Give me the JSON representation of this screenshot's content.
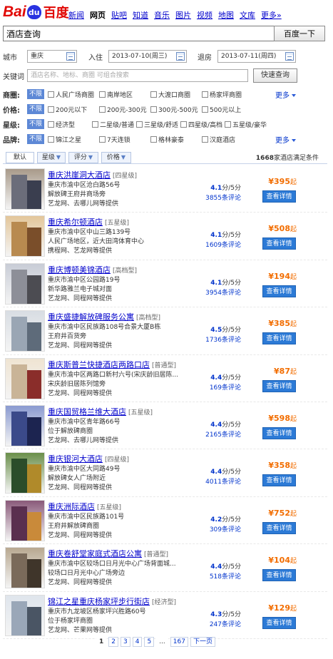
{
  "brand": {
    "logo_left": "Bai",
    "logo_paw": "du",
    "logo_right": "百度"
  },
  "nav": [
    "新闻",
    "网页",
    "贴吧",
    "知道",
    "音乐",
    "图片",
    "视频",
    "地图",
    "文库",
    "更多»"
  ],
  "search": {
    "value": "酒店查询",
    "button": "百度一下"
  },
  "filters": {
    "city_label": "城市",
    "city_value": "重庆",
    "checkin_label": "入住",
    "checkin_value": "2013-07-10(周三)",
    "checkout_label": "退房",
    "checkout_value": "2013-07-11(周四)",
    "keyword_label": "关键词",
    "keyword_placeholder": "酒店名称、地标、商圈 可组合搜索",
    "query_button": "快速查询",
    "unlimited": "不限",
    "more": "更多",
    "rows": [
      {
        "label": "商圈:",
        "options": [
          "人民广场商圈",
          "南岸地区",
          "大渡口商圈",
          "杨家坪商圈"
        ],
        "more": true
      },
      {
        "label": "价格:",
        "options": [
          "200元以下",
          "200元-300元",
          "300元-500元",
          "500元以上"
        ],
        "more": false
      },
      {
        "label": "星级:",
        "options": [
          "经济型",
          "二星级/普通",
          "三星级/舒适",
          "四星级/高档",
          "五星级/豪华"
        ],
        "more": false
      },
      {
        "label": "品牌:",
        "options": [
          "锦江之星",
          "7天连锁",
          "格林豪泰",
          "汉庭酒店"
        ],
        "more": true
      }
    ]
  },
  "sort": {
    "default": "默认",
    "star": "星级",
    "score": "评分",
    "price": "价格",
    "count_prefix": "1668",
    "count_suffix": "家酒店满足条件"
  },
  "hotels": [
    {
      "name": "重庆洪崖洞大酒店",
      "star": "[四星级]",
      "line1": "重庆市渝中区沧白路56号",
      "line2": "解放碑王府井商场旁",
      "line3": "艺龙网、去哪儿网等提供",
      "score": "4.1",
      "score_suffix": "分/5分",
      "reviews": "3855条评论",
      "price": "¥395",
      "price_suffix": "起",
      "detail": "查看详情",
      "palette": [
        "#6b6d7a",
        "#3a3e4f",
        "#a89a8a"
      ]
    },
    {
      "name": "重庆希尔顿酒店",
      "star": "[五星级]",
      "line1": "重庆市渝中区中山三路139号",
      "line2": "人民广场地区，近大田湾体育中心",
      "line3": "携程网、艺龙网等提供",
      "score": "4.1",
      "score_suffix": "分/5分",
      "reviews": "1609条评论",
      "price": "¥508",
      "price_suffix": "起",
      "detail": "查看详情",
      "palette": [
        "#b88a50",
        "#7a4e2a",
        "#e3c69a"
      ]
    },
    {
      "name": "重庆博顿美锦酒店",
      "star": "[高档型]",
      "line1": "重庆市渝中区公园路19号",
      "line2": "新华路雅兰电子城对面",
      "line3": "艺龙网、同程网等提供",
      "score": "4.1",
      "score_suffix": "分/5分",
      "reviews": "3954条评论",
      "price": "¥194",
      "price_suffix": "起",
      "detail": "查看详情",
      "palette": [
        "#8d8f98",
        "#4c4c52",
        "#c8ccd6"
      ]
    },
    {
      "name": "重庆盛捷解放碑服务公寓",
      "star": "[高档型]",
      "line1": "重庆市渝中区民族路108号合景大厦B栋",
      "line2": "王府井百货旁",
      "line3": "艺龙网、同程网等提供",
      "score": "4.5",
      "score_suffix": "分/5分",
      "reviews": "1736条评论",
      "price": "¥385",
      "price_suffix": "起",
      "detail": "查看详情",
      "palette": [
        "#9aa6b4",
        "#5e6b7a",
        "#d8dde3"
      ]
    },
    {
      "name": "重庆斯普兰快捷酒店两路口店",
      "star": "[普通型]",
      "line1": "重庆市渝中区两路口新村六号(宋庆龄旧居陈...",
      "line2": "宋庆龄旧居陈列馆旁",
      "line3": "艺龙网、同程网等提供",
      "score": "4.4",
      "score_suffix": "分/5分",
      "reviews": "169条评论",
      "price": "¥87",
      "price_suffix": "起",
      "detail": "查看详情",
      "palette": [
        "#c9b497",
        "#8a2d2a",
        "#efe4d2"
      ]
    },
    {
      "name": "重庆国贸格兰维大酒店",
      "star": "[五星级]",
      "line1": "重庆市渝中区青年路66号",
      "line2": "位于解放碑商圈",
      "line3": "艺龙网、去哪儿网等提供",
      "score": "4.4",
      "score_suffix": "分/5分",
      "reviews": "2165条评论",
      "price": "¥598",
      "price_suffix": "起",
      "detail": "查看详情",
      "palette": [
        "#3b4a8a",
        "#1c2450",
        "#8a9ad0"
      ]
    },
    {
      "name": "重庆银河大酒店",
      "star": "[四星级]",
      "line1": "重庆市渝中区大同路49号",
      "line2": "解放碑女人广场附近",
      "line3": "艺龙网、同程网等提供",
      "score": "4.4",
      "score_suffix": "分/5分",
      "reviews": "4011条评论",
      "price": "¥358",
      "price_suffix": "起",
      "detail": "查看详情",
      "palette": [
        "#2b4d2a",
        "#b08a2a",
        "#6a8f4a"
      ]
    },
    {
      "name": "重庆洲际酒店",
      "star": "[五星级]",
      "line1": "重庆市渝中区民族路101号",
      "line2": "王府井解放碑商圈",
      "line3": "艺龙网、同程网等提供",
      "score": "4.2",
      "score_suffix": "分/5分",
      "reviews": "309条评论",
      "price": "¥752",
      "price_suffix": "起",
      "detail": "查看详情",
      "palette": [
        "#5a2f4f",
        "#c98a3a",
        "#8a5a7a"
      ]
    },
    {
      "name": "重庆卷舒堂家庭式酒店公寓",
      "star": "[普通型]",
      "line1": "重庆市渝中区较场口日月光中心广场背面城...",
      "line2": "较场口日月光中心广场旁边",
      "line3": "艺龙网、同程网等提供",
      "score": "4.4",
      "score_suffix": "分/5分",
      "reviews": "518条评论",
      "price": "¥104",
      "price_suffix": "起",
      "detail": "查看详情",
      "palette": [
        "#7a6a5a",
        "#3f352a",
        "#b8a890"
      ]
    },
    {
      "name": "锦江之星重庆杨家坪步行街店",
      "star": "[经济型]",
      "line1": "重庆市九龙坡区杨家坪兴胜路60号",
      "line2": "位于杨家坪商圈",
      "line3": "艺龙网、芒果网等提供",
      "score": "4.3",
      "score_suffix": "分/5分",
      "reviews": "247条评论",
      "price": "¥129",
      "price_suffix": "起",
      "detail": "查看详情",
      "palette": [
        "#9aa7b8",
        "#4a5564",
        "#dfe5ec"
      ]
    }
  ],
  "pager": {
    "pages": [
      "1",
      "2",
      "3",
      "4",
      "5"
    ],
    "dots": "...",
    "last": "167",
    "next": "下一页"
  }
}
